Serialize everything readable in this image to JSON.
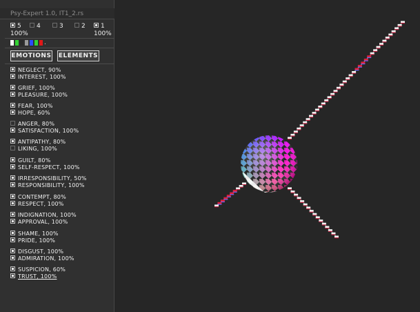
{
  "app": {
    "title": "Psy-Expert 1.0, IT1_2.rs"
  },
  "levels": [
    {
      "label": "5",
      "checked": true
    },
    {
      "label": "4",
      "checked": false
    },
    {
      "label": "3",
      "checked": false
    },
    {
      "label": "2",
      "checked": false
    },
    {
      "label": "1",
      "checked": true
    }
  ],
  "range": {
    "min": "100%",
    "max": "100%"
  },
  "swatches": [
    "#ffffff",
    "#33d233",
    "#2a2a2a",
    "#9a9a9a",
    "#2a4cff",
    "#33d233",
    "#e01818"
  ],
  "swatch_tail": ".",
  "tabs": {
    "emotions": "EMOTIONS",
    "elements": "ELEMENTS"
  },
  "emotions": [
    {
      "a": "NEGLECT, 90%",
      "a_on": true,
      "b": "INTEREST, 100%",
      "b_on": true
    },
    {
      "a": "GRIEF, 100%",
      "a_on": true,
      "b": "PLEASURE, 100%",
      "b_on": true
    },
    {
      "a": "FEAR, 100%",
      "a_on": true,
      "b": "HOPE, 60%",
      "b_on": true
    },
    {
      "a": "ANGER, 80%",
      "a_on": false,
      "b": "SATISFACTION, 100%",
      "b_on": true
    },
    {
      "a": "ANTIPATHY, 80%",
      "a_on": true,
      "b": "LIKING, 100%",
      "b_on": false
    },
    {
      "a": "GUILT, 80%",
      "a_on": true,
      "b": "SELF-RESPECT, 100%",
      "b_on": true
    },
    {
      "a": "IRRESPONSIBILITY, 50%",
      "a_on": true,
      "b": "RESPONSIBILITY, 100%",
      "b_on": true
    },
    {
      "a": "CONTEMPT, 80%",
      "a_on": true,
      "b": "RESPECT, 100%",
      "b_on": true
    },
    {
      "a": "INDIGNATION, 100%",
      "a_on": true,
      "b": "APPROVAL, 100%",
      "b_on": true
    },
    {
      "a": "SHAME, 100%",
      "a_on": true,
      "b": "PRIDE, 100%",
      "b_on": true
    },
    {
      "a": "DISGUST, 100%",
      "a_on": true,
      "b": "ADMIRATION, 100%",
      "b_on": true
    },
    {
      "a": "SUSPICION, 60%",
      "a_on": true,
      "b": "TRUST, 100%",
      "b_on": true,
      "b_selected": true
    }
  ]
}
